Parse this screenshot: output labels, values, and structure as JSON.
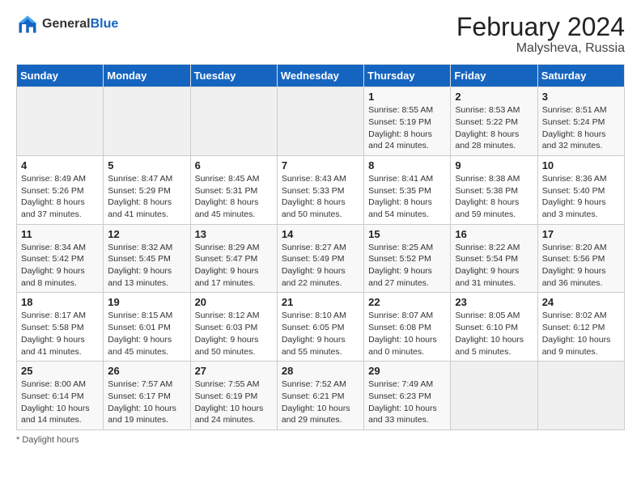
{
  "logo": {
    "general": "General",
    "blue": "Blue"
  },
  "header": {
    "month": "February 2024",
    "location": "Malysheva, Russia"
  },
  "weekdays": [
    "Sunday",
    "Monday",
    "Tuesday",
    "Wednesday",
    "Thursday",
    "Friday",
    "Saturday"
  ],
  "weeks": [
    [
      {
        "day": "",
        "info": ""
      },
      {
        "day": "",
        "info": ""
      },
      {
        "day": "",
        "info": ""
      },
      {
        "day": "",
        "info": ""
      },
      {
        "day": "1",
        "info": "Sunrise: 8:55 AM\nSunset: 5:19 PM\nDaylight: 8 hours and 24 minutes."
      },
      {
        "day": "2",
        "info": "Sunrise: 8:53 AM\nSunset: 5:22 PM\nDaylight: 8 hours and 28 minutes."
      },
      {
        "day": "3",
        "info": "Sunrise: 8:51 AM\nSunset: 5:24 PM\nDaylight: 8 hours and 32 minutes."
      }
    ],
    [
      {
        "day": "4",
        "info": "Sunrise: 8:49 AM\nSunset: 5:26 PM\nDaylight: 8 hours and 37 minutes."
      },
      {
        "day": "5",
        "info": "Sunrise: 8:47 AM\nSunset: 5:29 PM\nDaylight: 8 hours and 41 minutes."
      },
      {
        "day": "6",
        "info": "Sunrise: 8:45 AM\nSunset: 5:31 PM\nDaylight: 8 hours and 45 minutes."
      },
      {
        "day": "7",
        "info": "Sunrise: 8:43 AM\nSunset: 5:33 PM\nDaylight: 8 hours and 50 minutes."
      },
      {
        "day": "8",
        "info": "Sunrise: 8:41 AM\nSunset: 5:35 PM\nDaylight: 8 hours and 54 minutes."
      },
      {
        "day": "9",
        "info": "Sunrise: 8:38 AM\nSunset: 5:38 PM\nDaylight: 8 hours and 59 minutes."
      },
      {
        "day": "10",
        "info": "Sunrise: 8:36 AM\nSunset: 5:40 PM\nDaylight: 9 hours and 3 minutes."
      }
    ],
    [
      {
        "day": "11",
        "info": "Sunrise: 8:34 AM\nSunset: 5:42 PM\nDaylight: 9 hours and 8 minutes."
      },
      {
        "day": "12",
        "info": "Sunrise: 8:32 AM\nSunset: 5:45 PM\nDaylight: 9 hours and 13 minutes."
      },
      {
        "day": "13",
        "info": "Sunrise: 8:29 AM\nSunset: 5:47 PM\nDaylight: 9 hours and 17 minutes."
      },
      {
        "day": "14",
        "info": "Sunrise: 8:27 AM\nSunset: 5:49 PM\nDaylight: 9 hours and 22 minutes."
      },
      {
        "day": "15",
        "info": "Sunrise: 8:25 AM\nSunset: 5:52 PM\nDaylight: 9 hours and 27 minutes."
      },
      {
        "day": "16",
        "info": "Sunrise: 8:22 AM\nSunset: 5:54 PM\nDaylight: 9 hours and 31 minutes."
      },
      {
        "day": "17",
        "info": "Sunrise: 8:20 AM\nSunset: 5:56 PM\nDaylight: 9 hours and 36 minutes."
      }
    ],
    [
      {
        "day": "18",
        "info": "Sunrise: 8:17 AM\nSunset: 5:58 PM\nDaylight: 9 hours and 41 minutes."
      },
      {
        "day": "19",
        "info": "Sunrise: 8:15 AM\nSunset: 6:01 PM\nDaylight: 9 hours and 45 minutes."
      },
      {
        "day": "20",
        "info": "Sunrise: 8:12 AM\nSunset: 6:03 PM\nDaylight: 9 hours and 50 minutes."
      },
      {
        "day": "21",
        "info": "Sunrise: 8:10 AM\nSunset: 6:05 PM\nDaylight: 9 hours and 55 minutes."
      },
      {
        "day": "22",
        "info": "Sunrise: 8:07 AM\nSunset: 6:08 PM\nDaylight: 10 hours and 0 minutes."
      },
      {
        "day": "23",
        "info": "Sunrise: 8:05 AM\nSunset: 6:10 PM\nDaylight: 10 hours and 5 minutes."
      },
      {
        "day": "24",
        "info": "Sunrise: 8:02 AM\nSunset: 6:12 PM\nDaylight: 10 hours and 9 minutes."
      }
    ],
    [
      {
        "day": "25",
        "info": "Sunrise: 8:00 AM\nSunset: 6:14 PM\nDaylight: 10 hours and 14 minutes."
      },
      {
        "day": "26",
        "info": "Sunrise: 7:57 AM\nSunset: 6:17 PM\nDaylight: 10 hours and 19 minutes."
      },
      {
        "day": "27",
        "info": "Sunrise: 7:55 AM\nSunset: 6:19 PM\nDaylight: 10 hours and 24 minutes."
      },
      {
        "day": "28",
        "info": "Sunrise: 7:52 AM\nSunset: 6:21 PM\nDaylight: 10 hours and 29 minutes."
      },
      {
        "day": "29",
        "info": "Sunrise: 7:49 AM\nSunset: 6:23 PM\nDaylight: 10 hours and 33 minutes."
      },
      {
        "day": "",
        "info": ""
      },
      {
        "day": "",
        "info": ""
      }
    ]
  ],
  "footer": {
    "note": "Daylight hours"
  }
}
